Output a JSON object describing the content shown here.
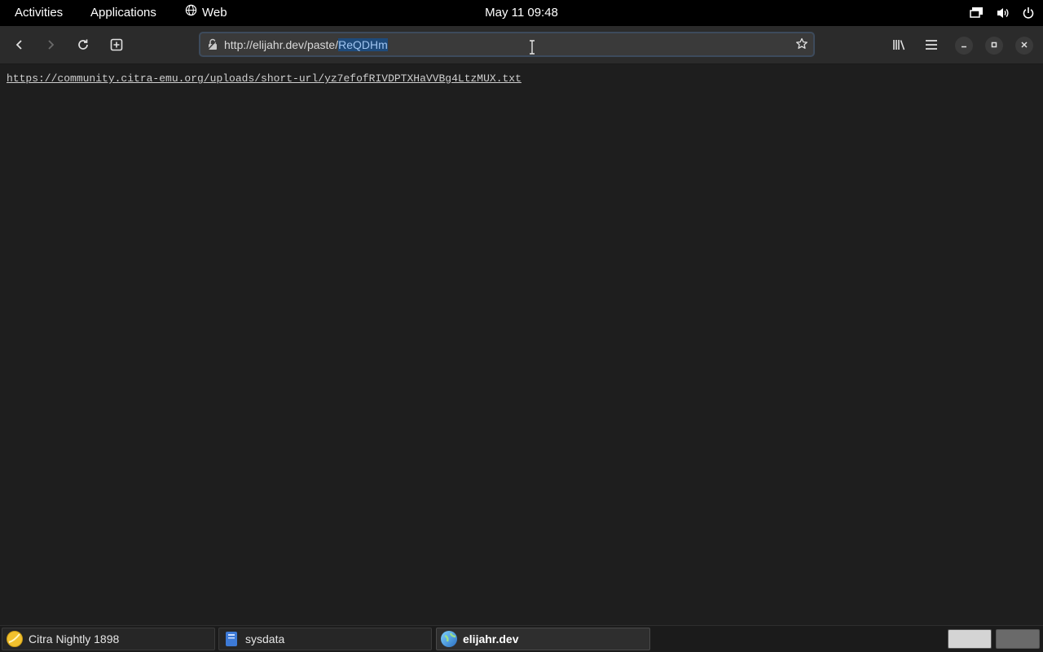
{
  "topbar": {
    "activities": "Activities",
    "applications": "Applications",
    "web": "Web",
    "clock": "May 11  09:48"
  },
  "browser": {
    "url_prefix": "http://elijahr.dev/paste/",
    "url_selected": "ReQDHm"
  },
  "page": {
    "content_link": "https://community.citra-emu.org/uploads/short-url/yz7efofRIVDPTXHaVVBg4LtzMUX.txt"
  },
  "taskbar": {
    "tasks": [
      {
        "label": "Citra Nightly 1898",
        "icon": "citra-icon"
      },
      {
        "label": "sysdata",
        "icon": "file-manager-icon"
      },
      {
        "label": "elijahr.dev",
        "icon": "web-browser-icon"
      }
    ]
  },
  "colors": {
    "accent_selection": "#1e4a7a",
    "page_background": "#1e1e1e"
  }
}
